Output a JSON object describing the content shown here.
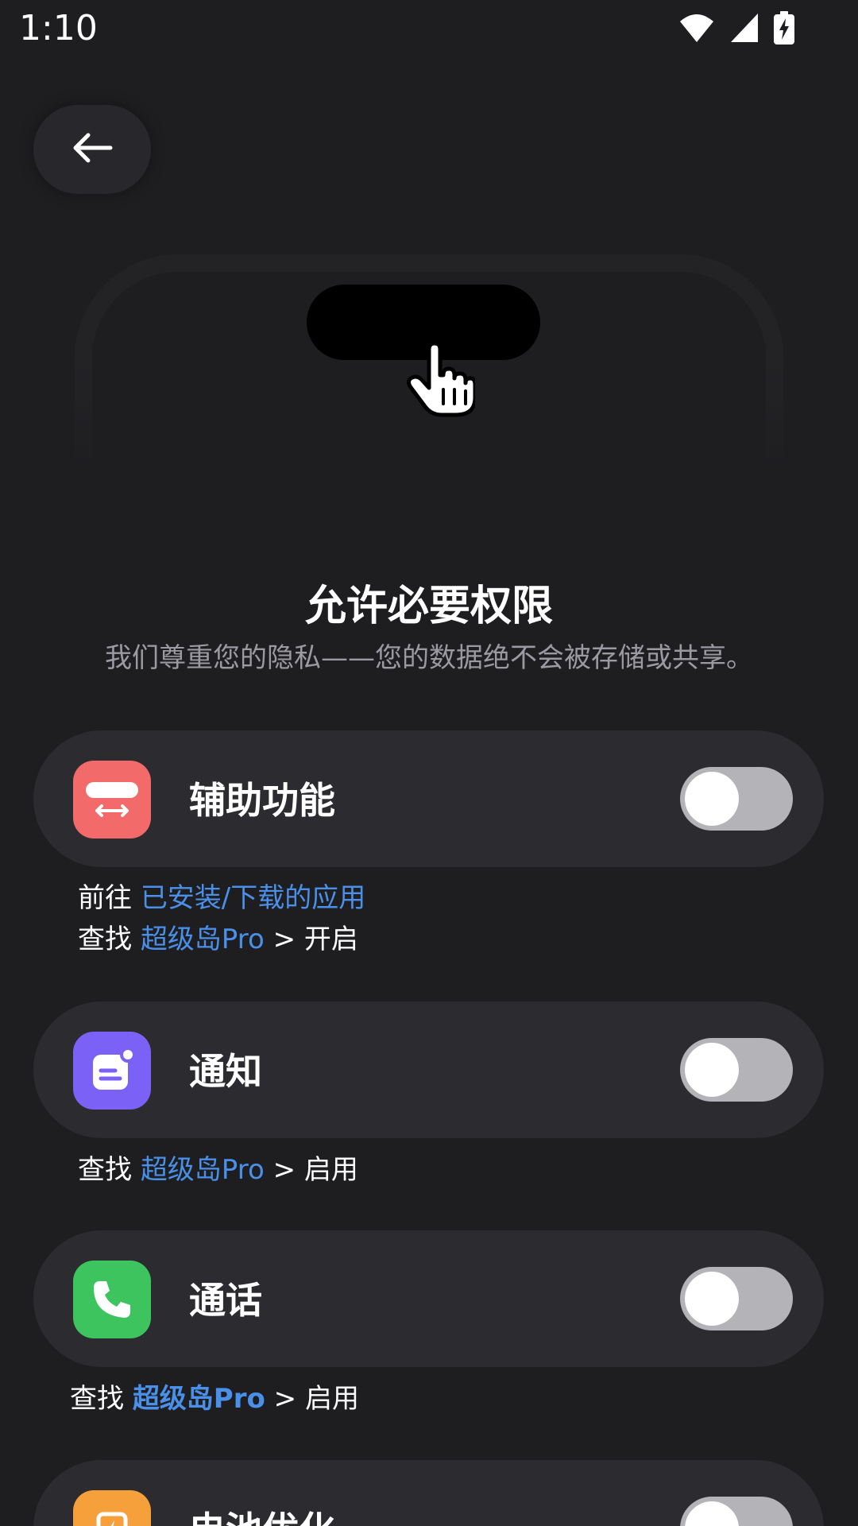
{
  "status_bar": {
    "time": "1:10",
    "icons": [
      "wifi-icon",
      "signal-icon",
      "battery-charging-icon"
    ]
  },
  "back_button": {
    "icon": "arrow-left-icon"
  },
  "illustration": {
    "icons": [
      "dynamic-island",
      "hand-cursor-icon"
    ]
  },
  "header": {
    "title": "允许必要权限",
    "subtitle": "我们尊重您的隐私——您的数据绝不会被存储或共享。"
  },
  "permissions": [
    {
      "label": "辅助功能",
      "icon": "accessibility-icon",
      "icon_color": "#f26a6a",
      "enabled": false,
      "hint_lines": [
        {
          "prefix": "前往 ",
          "link": "已安装/下载的应用",
          "suffix": ""
        },
        {
          "prefix": "查找 ",
          "link": "超级岛Pro",
          "suffix": " > 开启"
        }
      ]
    },
    {
      "label": "通知",
      "icon": "notification-icon",
      "icon_color": "#7b61f5",
      "enabled": false,
      "hint_lines": [
        {
          "prefix": "查找 ",
          "link": "超级岛Pro",
          "suffix": " > 启用"
        }
      ]
    },
    {
      "label": "通话",
      "icon": "phone-icon",
      "icon_color": "#3dc45f",
      "enabled": false,
      "hint_lines": [
        {
          "prefix": "查找 ",
          "link": "超级岛Pro",
          "suffix": " > 启用"
        }
      ]
    },
    {
      "label": "电池优化",
      "icon": "battery-optimization-icon",
      "icon_color": "#f5a03a",
      "enabled": false,
      "hint_lines": []
    }
  ],
  "colors": {
    "background": "#1e1e21",
    "card": "#2c2c30",
    "link": "#4a90e8",
    "toggle_off": "#b4b4b8"
  }
}
